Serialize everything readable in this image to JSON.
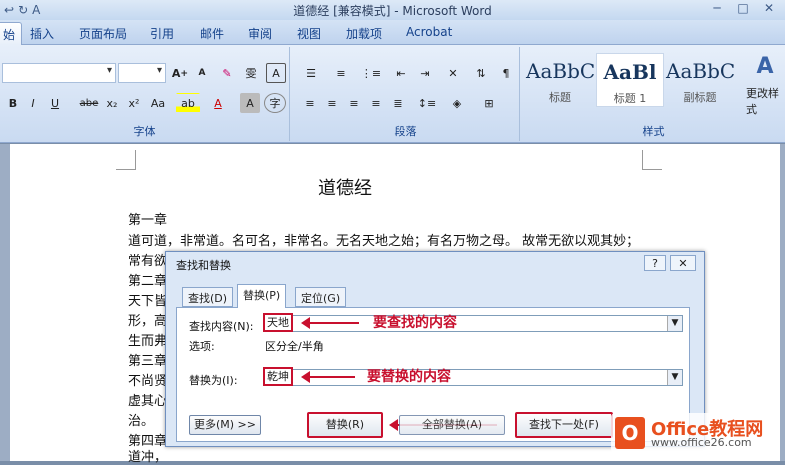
{
  "window": {
    "title": "道德经 [兼容模式] - Microsoft Word",
    "qat": [
      "↩",
      "↻",
      "A"
    ],
    "controls": [
      "─",
      "□",
      "✕"
    ]
  },
  "ribbon_tabs": [
    "始",
    "插入",
    "页面布局",
    "引用",
    "邮件",
    "审阅",
    "视图",
    "加载项",
    "Acrobat"
  ],
  "ribbon": {
    "font_group": "字体",
    "font_buttons": [
      "B",
      "I",
      "U",
      "abe",
      "x₂",
      "x²",
      "Aa",
      "A",
      "A"
    ],
    "paragraph_group": "段落",
    "styles_group": "样式",
    "styles": [
      {
        "sample": "AaBbC",
        "name": "标题"
      },
      {
        "sample": "AaBl",
        "name": "标题 1"
      },
      {
        "sample": "AaBbC",
        "name": "副标题"
      }
    ],
    "change_style": "更改样式"
  },
  "document": {
    "title": "道德经",
    "lines": [
      "第一章",
      "道可道，非常道。名可名，非常名。无名天地之始；有名万物之母。 故常无欲以观其妙；",
      "常有欲",
      "第二章",
      "天下皆",
      "形，高",
      "生而弗",
      "第三章",
      "不尚贤",
      "虚其心",
      "治。",
      "第四章",
      "道冲，"
    ]
  },
  "dialog": {
    "title": "查找和替换",
    "help": "?",
    "close": "✕",
    "tabs": [
      "查找(D)",
      "替换(P)",
      "定位(G)"
    ],
    "find_label": "查找内容(N):",
    "find_value": "天地",
    "options_label": "选项:",
    "options_value": "区分全/半角",
    "replace_label": "替换为(I):",
    "replace_value": "乾坤",
    "buttons": {
      "more": "更多(M) >>",
      "replace": "替换(R)",
      "replace_all": "全部替换(A)",
      "find_next": "查找下一处(F)"
    },
    "annotation_find": "要查找的内容",
    "annotation_replace": "要替换的内容"
  },
  "watermark": {
    "brand": "Office教程网",
    "url": "www.office26.com"
  }
}
